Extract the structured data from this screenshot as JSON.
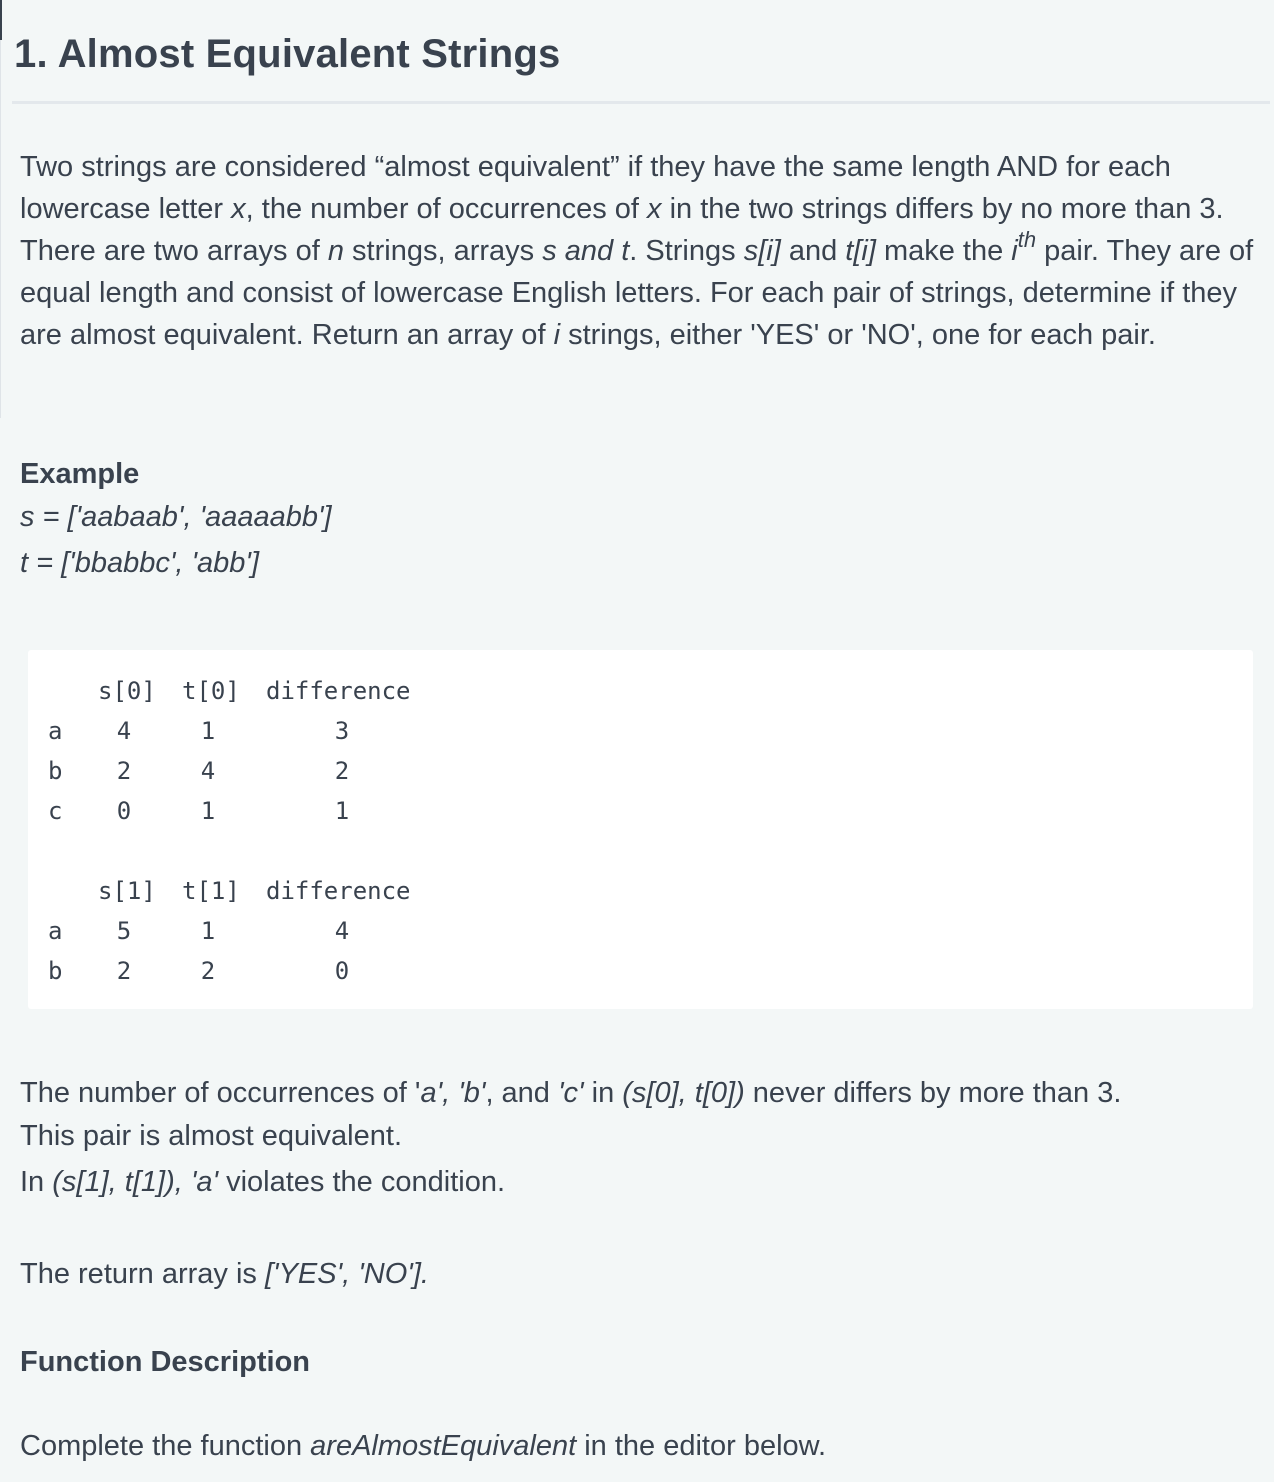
{
  "title": "1. Almost Equivalent Strings",
  "intro": {
    "text_1": "Two strings are considered “almost equivalent” if they have the same length AND for each lowercase letter ",
    "var_x1": "x",
    "text_2": ", the number of occurrences of ",
    "var_x2": "x",
    "text_3": " in the two strings differs by no more than 3. There are two arrays of ",
    "var_n": "n",
    "text_4": " strings, arrays ",
    "var_st": "s and t",
    "text_5": ". Strings ",
    "var_si": "s[i]",
    "text_6": " and ",
    "var_ti": "t[i]",
    "text_7": " make the ",
    "var_i": "i",
    "sup_th": "th",
    "text_8": " pair. They are of equal length and consist of lowercase English letters. For each pair of strings, determine if they are almost equivalent. Return an array of ",
    "var_i2": "i",
    "text_9": " strings, either 'YES' or 'NO', one for each pair."
  },
  "example": {
    "heading": "Example",
    "s_line": "s = ['aabaab', 'aaaaabb']",
    "t_line": "t = ['bbabbc', 'abb']"
  },
  "tables": [
    {
      "headers": [
        "s[0]",
        "t[0]",
        "difference"
      ],
      "rows": [
        {
          "letter": "a",
          "s": "4",
          "t": "1",
          "diff": "3"
        },
        {
          "letter": "b",
          "s": "2",
          "t": "4",
          "diff": "2"
        },
        {
          "letter": "c",
          "s": "0",
          "t": "1",
          "diff": "1"
        }
      ]
    },
    {
      "headers": [
        "s[1]",
        "t[1]",
        "difference"
      ],
      "rows": [
        {
          "letter": "a",
          "s": "5",
          "t": "1",
          "diff": "4"
        },
        {
          "letter": "b",
          "s": "2",
          "t": "2",
          "diff": "0"
        }
      ]
    }
  ],
  "explanation": {
    "p1_a": "The number of occurrences of '",
    "p1_em1": "a', 'b'",
    "p1_b": ", and ",
    "p1_em2": "'c'",
    "p1_c": " in ",
    "p1_em3": "(s[0], t[0])",
    "p1_d": " never differs by more than 3.",
    "p2": "This pair is almost equivalent.",
    "p3_a": "In ",
    "p3_em1": "(s[1], t[1]), 'a'",
    "p3_b": " violates the condition.",
    "p4_a": "The return array is ",
    "p4_em": "['YES', 'NO']."
  },
  "function_description": {
    "heading": "Function Description",
    "text_a": "Complete the function ",
    "fn_name": "areAlmostEquivalent",
    "text_b": " in the editor below."
  }
}
